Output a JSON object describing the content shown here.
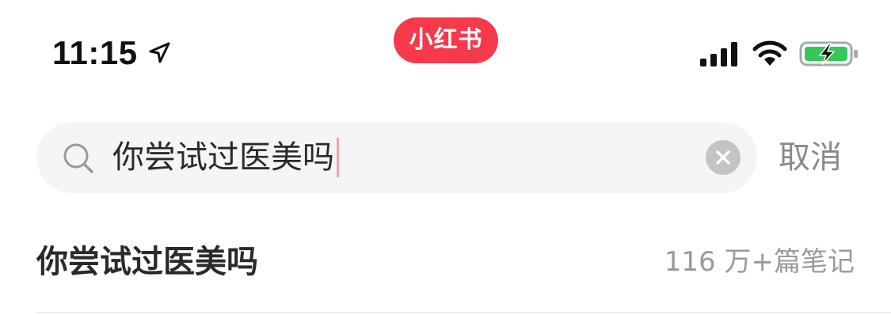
{
  "status_bar": {
    "time": "11:15",
    "app_badge": "小红书",
    "icons": [
      "location-arrow-icon",
      "cellular-signal-icon",
      "wifi-icon",
      "battery-charging-icon"
    ],
    "battery_color": "#34c759"
  },
  "search": {
    "value": "你尝试过医美吗",
    "cancel_label": "取消",
    "icons": [
      "search-icon",
      "clear-icon"
    ]
  },
  "suggestions": [
    {
      "title": "你尝试过医美吗",
      "count": "116 万+篇笔记"
    }
  ],
  "colors": {
    "brand": "#f6394b",
    "search_bg": "#f5f5f5",
    "muted_text": "#9a9a9a",
    "caret": "#f0a3ad"
  }
}
